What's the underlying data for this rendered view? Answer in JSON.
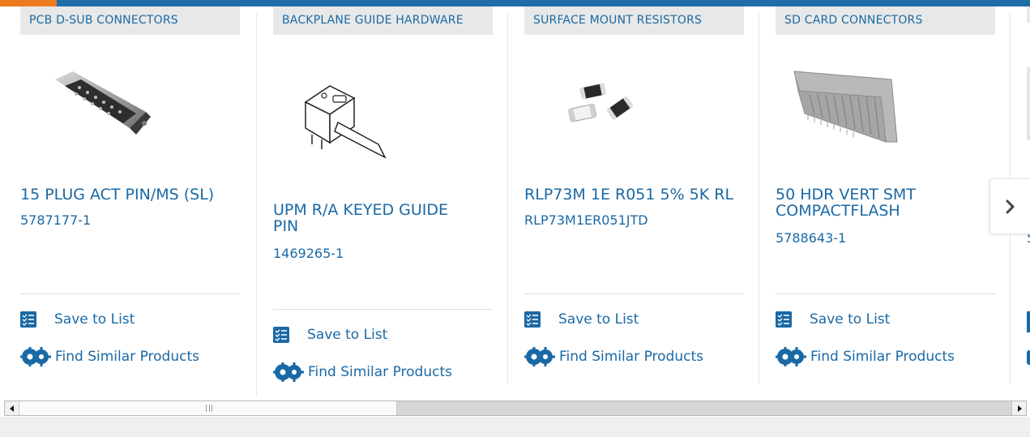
{
  "cards": [
    {
      "category": "PCB D-SUB CONNECTORS",
      "product_name": "15 PLUG ACT PIN/MS (SL)",
      "part_number": "5787177-1",
      "save_label": "Save to List",
      "similar_label": "Find Similar Products"
    },
    {
      "category": "BACKPLANE GUIDE HARDWARE",
      "product_name": "UPM R/A KEYED GUIDE PIN",
      "part_number": "1469265-1",
      "save_label": "Save to List",
      "similar_label": "Find Similar Products"
    },
    {
      "category": "SURFACE MOUNT RESISTORS",
      "product_name": "RLP73M 1E R051 5% 5K RL",
      "part_number": "RLP73M1ER051JTD",
      "save_label": "Save to List",
      "similar_label": "Find Similar Products"
    },
    {
      "category": "SD CARD CONNECTORS",
      "product_name": "50 HDR VERT SMT COMPACTFLASH",
      "part_number": "5788643-1",
      "save_label": "Save to List",
      "similar_label": "Find Similar Products"
    },
    {
      "category": "",
      "product_name": "",
      "part_number": "5",
      "save_label": "",
      "similar_label": ""
    }
  ],
  "carousel": {
    "next_icon": "chevron-right-icon"
  },
  "icons": {
    "save": "list-check-icon",
    "similar": "gears-icon"
  },
  "colors": {
    "accent_orange": "#ee7a1e",
    "brand_blue": "#1f6ea8",
    "link_blue": "#1a69a5",
    "tag_bg": "#e8e8e8"
  }
}
